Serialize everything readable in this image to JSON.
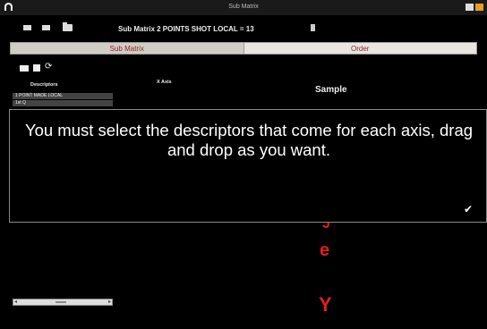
{
  "window": {
    "title": "Sub Matrix"
  },
  "toolbar": {
    "matrix_title": "Sub Matrix 2 POINTS SHOT LOCAL = 13",
    "icons": [
      "menu-icon",
      "film-icon",
      "folder-icon",
      "trash-icon"
    ]
  },
  "tabs": [
    {
      "label": "Sub Matrix",
      "active": true
    },
    {
      "label": "Order",
      "active": false
    }
  ],
  "panel": {
    "descriptors_header": "Descriptors",
    "xaxis_header": "X Axis",
    "sample_header": "Sample",
    "descriptors": [
      "1 POINT MADE LOCAL",
      "1st Q"
    ]
  },
  "overlay": {
    "message": "You must select the descriptors that come for each axis, drag and drop as you want."
  },
  "y_axis_letters": [
    "J",
    "e",
    "Y"
  ],
  "colors": {
    "accent_red": "#e31e1e",
    "close_button": "#e8a020"
  }
}
